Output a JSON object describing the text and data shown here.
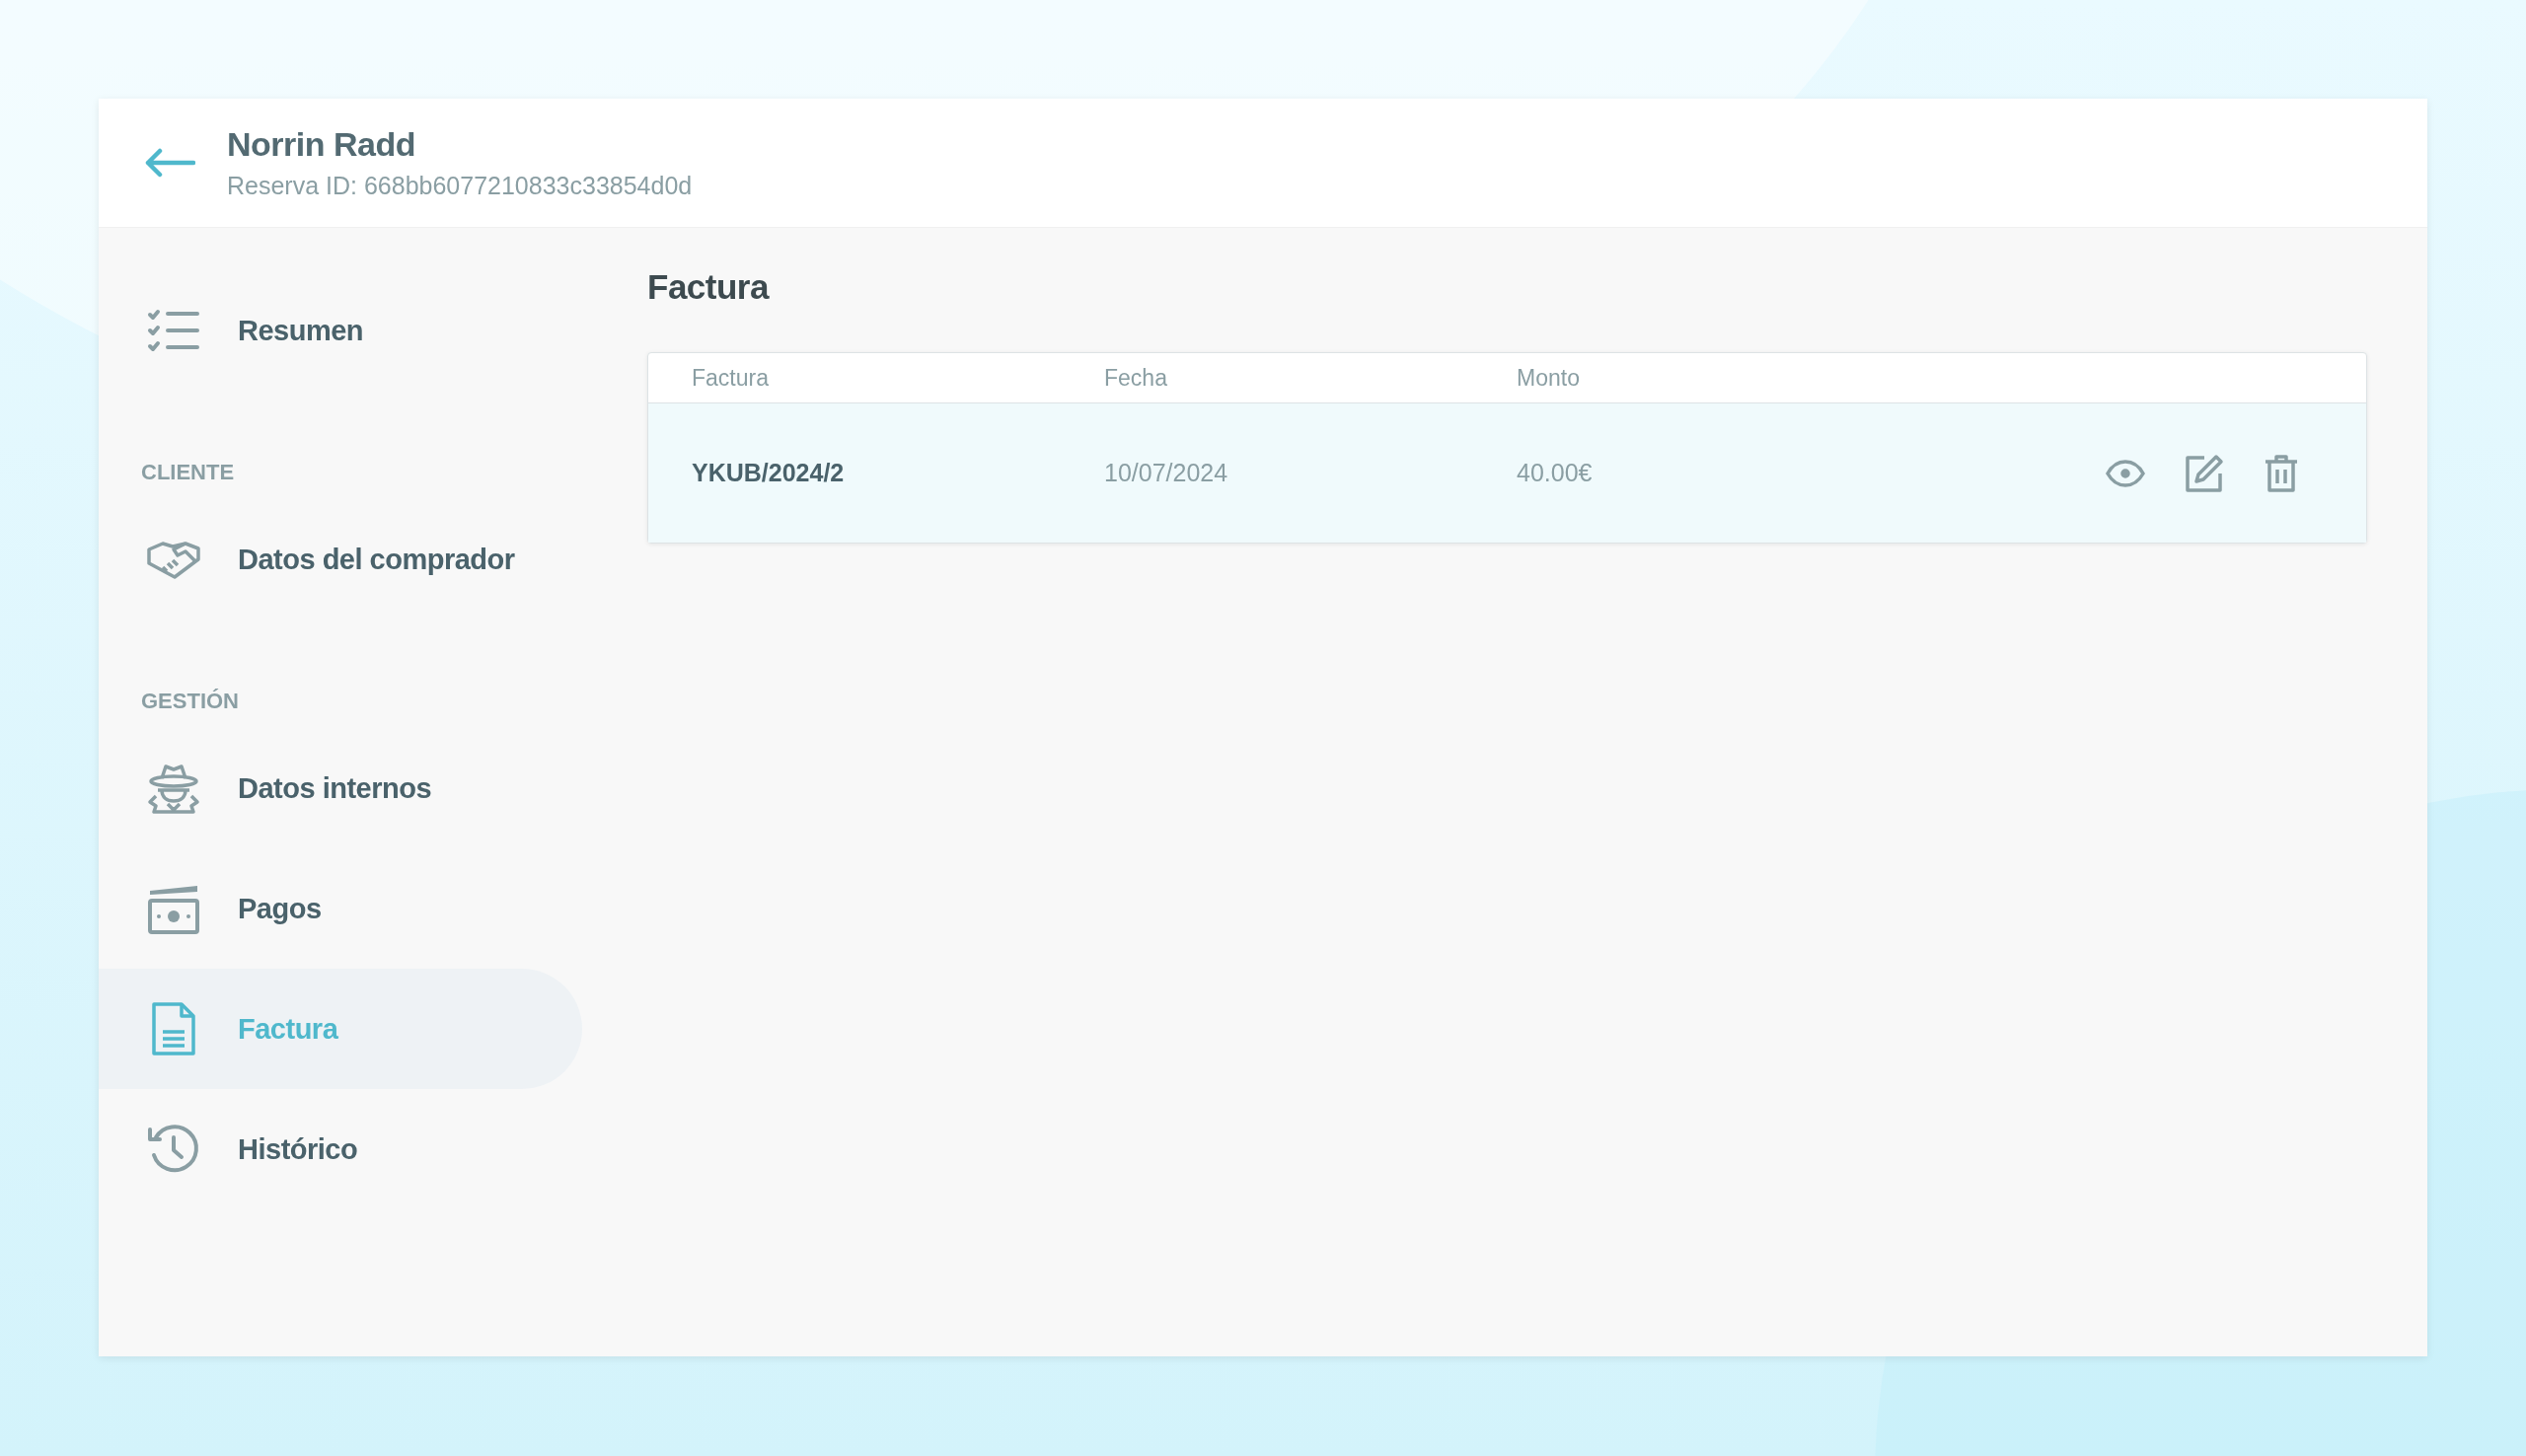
{
  "header": {
    "title": "Norrin Radd",
    "subtitle": "Reserva ID: 668bb6077210833c33854d0d"
  },
  "sidebar": {
    "groups": [
      {
        "items": [
          {
            "label": "Resumen",
            "selected": false
          }
        ]
      },
      {
        "heading": "CLIENTE",
        "items": [
          {
            "label": "Datos del comprador",
            "selected": false
          }
        ]
      },
      {
        "heading": "GESTIÓN",
        "items": [
          {
            "label": "Datos internos",
            "selected": false
          },
          {
            "label": "Pagos",
            "selected": false
          },
          {
            "label": "Factura",
            "selected": true
          },
          {
            "label": "Histórico",
            "selected": false
          }
        ]
      }
    ]
  },
  "main": {
    "title": "Factura",
    "table": {
      "columns": [
        "Factura",
        "Fecha",
        "Monto"
      ],
      "rows": [
        {
          "cells": [
            "YKUB/2024/2",
            "10/07/2024",
            "40.00€"
          ]
        }
      ]
    }
  }
}
